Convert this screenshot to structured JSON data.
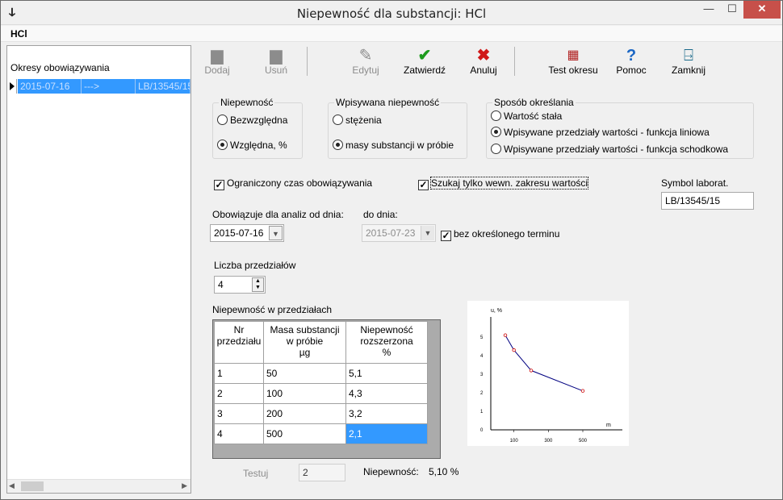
{
  "window": {
    "title": "Niepewność dla substancji: HCl",
    "min": "—",
    "max": "☐",
    "close": "✕"
  },
  "menu": {
    "label": "HCl"
  },
  "toolbar": {
    "dodaj": "Dodaj",
    "usun": "Usuń",
    "edytuj": "Edytuj",
    "zatwierdz": "Zatwierdź",
    "anuluj": "Anuluj",
    "test_okresu": "Test okresu",
    "pomoc": "Pomoc",
    "zamknij": "Zamknij"
  },
  "periods": {
    "header": "Okresy obowiązywania",
    "rows": [
      {
        "date": "2015-07-16",
        "arrow": "--->",
        "symbol": "LB/13545/15"
      }
    ]
  },
  "niepewnosc": {
    "legend": "Niepewność",
    "opt1": "Bezwzględna",
    "opt2": "Względna, %",
    "selected": "Względna, %"
  },
  "wpisywana": {
    "legend": "Wpisywana niepewność",
    "opt1": "stężenia",
    "opt2": "masy substancji w próbie",
    "selected": "masy substancji w próbie"
  },
  "sposob": {
    "legend": "Sposób określania",
    "opt1": "Wartość stała",
    "opt2": "Wpisywane przedziały wartości - funkcja  liniowa",
    "opt3": "Wpisywane przedziały wartości - funkcja  schodkowa",
    "selected": "Wpisywane przedziały wartości - funkcja  liniowa"
  },
  "options": {
    "ograniczony": "Ograniczony czas obowiązywania",
    "ograniczony_checked": true,
    "szukaj": "Szukaj tylko wewn. zakresu wartości",
    "szukaj_checked": true,
    "bez_terminu": "bez określonego terminu",
    "bez_terminu_checked": true
  },
  "symbol": {
    "label": "Symbol laborat.",
    "value": "LB/13545/15"
  },
  "dates": {
    "from_label": "Obowiązuje  dla analiz od dnia:",
    "from_value": "2015-07-16",
    "to_label": "do dnia:",
    "to_value": "2015-07-23"
  },
  "liczba": {
    "label": "Liczba przedziałów",
    "value": "4"
  },
  "table": {
    "title": "Niepewność w przedziałach",
    "headers": [
      "Nr\nprzedziału",
      "Masa substancji\nw próbie\nµg",
      "Niepewność\nrozszerzona\n%"
    ],
    "rows": [
      [
        "1",
        "50",
        "5,1"
      ],
      [
        "2",
        "100",
        "4,3"
      ],
      [
        "3",
        "200",
        "3,2"
      ],
      [
        "4",
        "500",
        "2,1"
      ]
    ]
  },
  "test": {
    "button": "Testuj",
    "input": "2",
    "result_label": "Niepewność:",
    "result_value": "5,10 %"
  },
  "graph": {
    "y_label": "u, %",
    "x_label": "m",
    "y_ticks": [
      "0",
      "1",
      "2",
      "3",
      "4",
      "5"
    ],
    "x_ticks": [
      "100",
      "300",
      "500"
    ],
    "points": [
      [
        50,
        5.1
      ],
      [
        100,
        4.3
      ],
      [
        200,
        3.2
      ],
      [
        500,
        2.1
      ]
    ],
    "line_color": "#000080",
    "point_color": "#cc0000"
  }
}
